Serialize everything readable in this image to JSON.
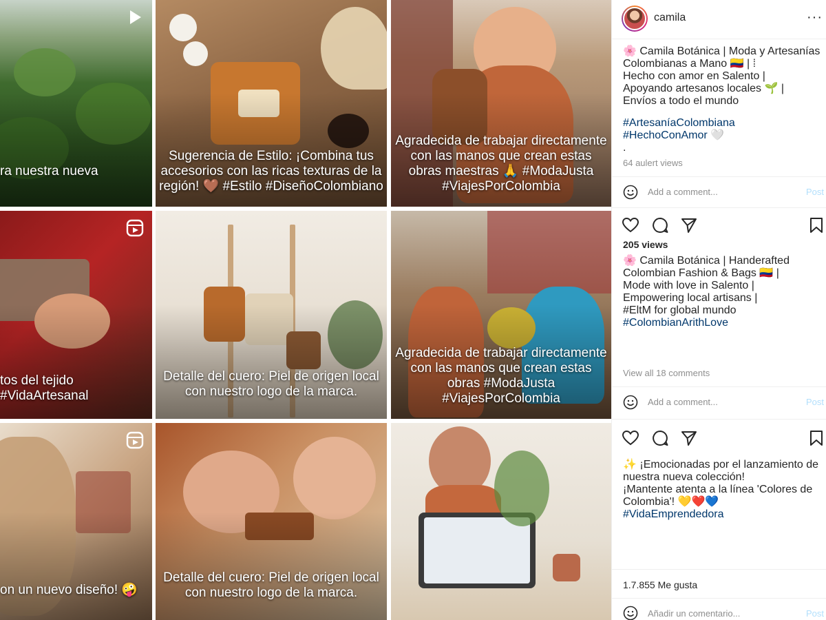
{
  "grid": {
    "tiles": [
      {
        "caption": "ra nuestra nueva",
        "badge": "play-icon"
      },
      {
        "caption": "Sugerencia de Estilo: ¡Combina tus accesorios con las ricas texturas de la región! 🤎 #Estilo #DiseñoColombiano",
        "badge": ""
      },
      {
        "caption": "Agradecida de trabajar directamente con las manos que crean estas obras maestras 🙏 #ModaJusta #ViajesPorColombia",
        "badge": ""
      },
      {
        "caption": "tos del tejido\n#VidaArtesanal",
        "badge": "reels-icon"
      },
      {
        "caption": "Detalle del cuero: Piel de origen local con nuestro logo de la marca.",
        "badge": ""
      },
      {
        "caption": "Agradecida de trabajar directamente con las manos que crean estas obras #ModaJusta #ViajesPorColombia",
        "badge": ""
      },
      {
        "caption": "on un nuevo diseño! 🤪",
        "badge": "reels-icon"
      },
      {
        "caption": "Detalle del cuero: Piel de origen local con nuestro logo de la marca.",
        "badge": ""
      },
      {
        "caption": "",
        "badge": ""
      }
    ]
  },
  "panel": {
    "username": "camila",
    "more_label": "···",
    "post1": {
      "bio_line1": "🌸 Camila Botánica | Moda y Artesanías Colombianas a Mano 🇨🇴 | ⁞",
      "bio_line2": "Hecho con amor en Salento |",
      "bio_line3": "Apoyando artesanos locales 🌱 |",
      "bio_line4": "Envíos a todo el mundo",
      "tag1": "#ArtesaníaColombiana",
      "tag2": "#HechoConAmor 🤍",
      "dot": ".",
      "views": "64 aulert views",
      "comment_placeholder": "Add a comment...",
      "post_label": "Post"
    },
    "post2": {
      "views": "205 views",
      "line1": "🌸 Camila Botánica | Handerafted Colombian Fashion & Bags 🇨🇴 |",
      "line2": "Mode with love in Salento |",
      "line3": "Empowering local artisans |",
      "line4": "#EltM for global mundo",
      "tag": "#ColombianArithLove",
      "view_all": "View all 18 comments",
      "comment_placeholder": "Add a comment...",
      "post_label": "Post"
    },
    "post3": {
      "line1": "✨ ¡Emocionadas por el lanzamiento de nuestra nueva colección!",
      "line2": "¡Mantente atenta a la línea 'Colores de Colombia'! 💛❤️💙",
      "tag": "#VidaEmprendedora",
      "likes": "1.7.855 Me gusta",
      "comment_placeholder": "Añadir un comentario...",
      "post_label": "Post"
    }
  },
  "colors": {
    "text": "#262626",
    "link": "#00376b",
    "muted": "#8e8e8e",
    "post": "#b2dffc"
  }
}
